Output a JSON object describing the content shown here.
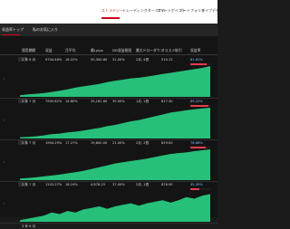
{
  "nav": {
    "items": [
      {
        "label": "ストラテジー",
        "active": true
      },
      {
        "label": "トレーディングターミナル",
        "active": false
      },
      {
        "label": "スマートポイント",
        "active": false
      },
      {
        "label": "ポートフォリオ",
        "active": false
      },
      {
        "label": "ライブデモ",
        "active": false
      }
    ]
  },
  "tabs": {
    "first": "収益率トップ",
    "second": "私のお気に入り"
  },
  "table": {
    "columns": [
      "運用期間",
      "収益",
      "月平均",
      "最Lpips",
      "DD収益極限",
      "最大ドローダウン",
      "オススメ取引",
      "収益率"
    ],
    "rows": [
      {
        "period": "2 年 6 月",
        "profit": "9704.46%",
        "monthly": "16.22%",
        "pips": "50,300.80",
        "dd": "31.00%",
        "drawdown": "2月, 4週",
        "recommend": "510.12",
        "ret": "81.61%",
        "fill": 0.82
      },
      {
        "period": "2 年 7 月",
        "profit": "7905.82%",
        "monthly": "14.80%",
        "pips": "25,181.60",
        "dd": "39.00%",
        "drawdown": "1月, 1週",
        "recommend": "817.30",
        "ret": "89.22%",
        "fill": 0.89
      },
      {
        "period": "2 年 7 月",
        "profit": "1904.29%",
        "monthly": "17.27%",
        "pips": "19,800.00",
        "dd": "21.00%",
        "drawdown": "2月, 2週",
        "recommend": "829.00",
        "ret": "78.68%",
        "fill": 0.79
      },
      {
        "period": "2 年 7 月",
        "profit": "1203.27%",
        "monthly": "16.19%",
        "pips": "4,878.25",
        "dd": "37.00%",
        "drawdown": "2月, 1週",
        "recommend": "876.90",
        "ret": "45.35%",
        "fill": 0.45
      }
    ],
    "last_period": "3 年 6 月"
  },
  "colors": {
    "chart_fill": "#27c07a",
    "accent": "#d0021b"
  }
}
